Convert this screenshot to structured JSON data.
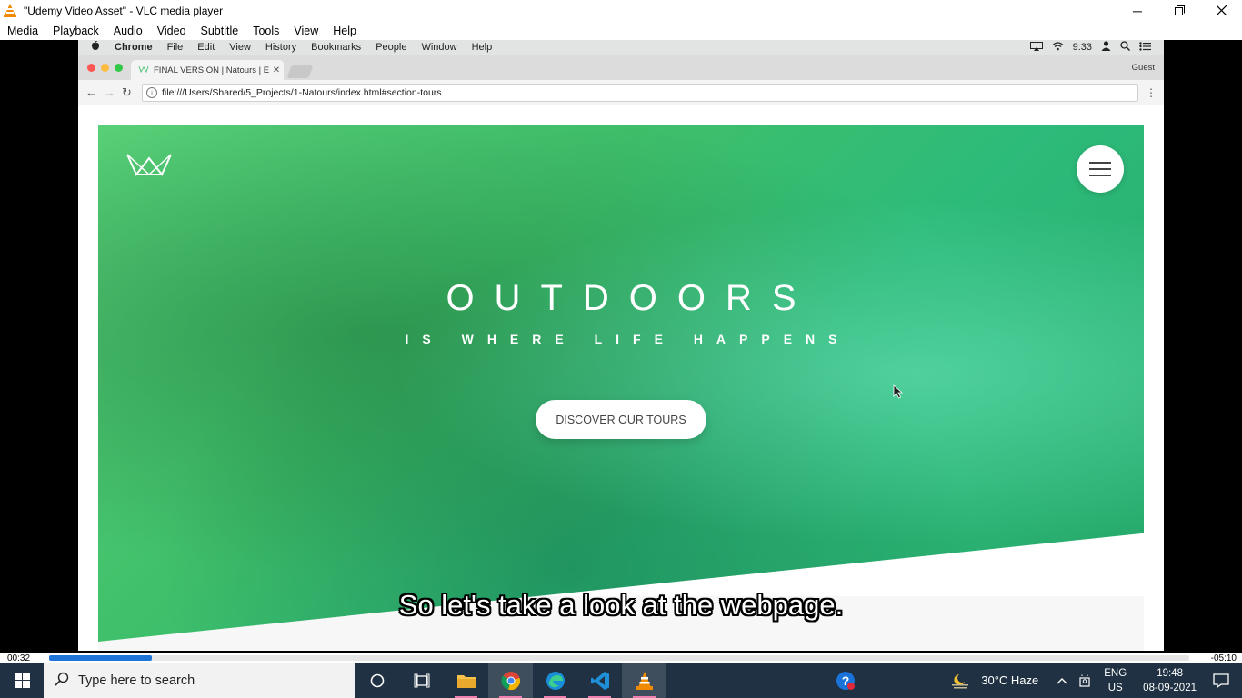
{
  "vlc": {
    "title": "\"Udemy Video Asset\" - VLC media player",
    "menu": [
      "Media",
      "Playback",
      "Audio",
      "Video",
      "Subtitle",
      "Tools",
      "View",
      "Help"
    ],
    "time_elapsed": "00:32",
    "time_remaining": "-05:10",
    "progress": 0.09,
    "subtitle": "So let's take a look at the webpage."
  },
  "mac": {
    "menu": [
      "Chrome",
      "File",
      "Edit",
      "View",
      "History",
      "Bookmarks",
      "People",
      "Window",
      "Help"
    ],
    "clock": "9:33"
  },
  "chrome": {
    "tab_title": "FINAL VERSION | Natours | Ex",
    "profile": "Guest",
    "url": "file:///Users/Shared/5_Projects/1-Natours/index.html#section-tours"
  },
  "hero": {
    "title": "OUTDOORS",
    "subtitle": "IS WHERE LIFE HAPPENS",
    "cta": "DISCOVER OUR TOURS"
  },
  "taskbar": {
    "search_placeholder": "Type here to search",
    "weather": "30°C  Haze",
    "lang_top": "ENG",
    "lang_bottom": "US",
    "time": "19:48",
    "date": "08-09-2021"
  }
}
